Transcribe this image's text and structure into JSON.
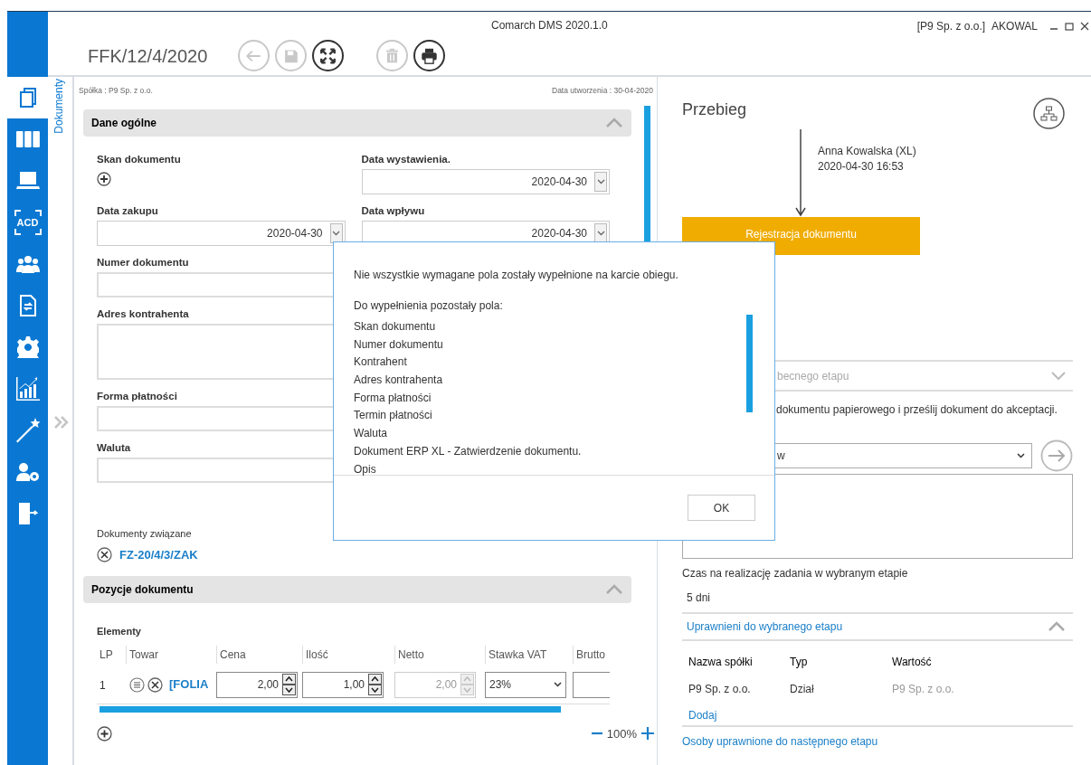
{
  "window": {
    "title": "Comarch DMS 2020.1.0",
    "company": "[P9 Sp. z o.o.]",
    "user": "AKOWAL"
  },
  "document": {
    "number": "FFK/12/4/2020"
  },
  "toolbar": [
    {
      "kind": "back",
      "disabled": true
    },
    {
      "kind": "save",
      "disabled": true
    },
    {
      "kind": "fullscreen",
      "disabled": false
    },
    {
      "kind": "delete",
      "disabled": true
    },
    {
      "kind": "print",
      "disabled": false
    }
  ],
  "sidebar": {
    "items": [
      {
        "kind": "documents",
        "selected": true
      },
      {
        "kind": "repository",
        "selected": false
      },
      {
        "kind": "workstation",
        "selected": false
      },
      {
        "kind": "ocr",
        "label": "ACD",
        "selected": false
      },
      {
        "kind": "users",
        "selected": false
      },
      {
        "kind": "workflow",
        "selected": false
      },
      {
        "kind": "settings",
        "selected": false
      },
      {
        "kind": "reports",
        "selected": false
      },
      {
        "kind": "wizard",
        "selected": false
      },
      {
        "kind": "user-settings",
        "selected": false
      },
      {
        "kind": "logout",
        "selected": false
      }
    ]
  },
  "side_tab": {
    "label": "Dokumenty"
  },
  "header_info": {
    "company": "Spółka : P9 Sp. z o.o.",
    "created": "Data utworzenia : 30-04-2020"
  },
  "general": {
    "title": "Dane ogólne",
    "expanded": true,
    "rows": [
      {
        "fields": [
          {
            "label": "Skan dokumentu",
            "kind": "attachment"
          },
          {
            "label": "Data wystawienia.",
            "kind": "date",
            "value": "2020-04-30"
          }
        ]
      },
      {
        "fields": [
          {
            "label": "Data zakupu",
            "kind": "date",
            "value": "2020-04-30"
          },
          {
            "label": "Data wpływu",
            "kind": "date",
            "value": "2020-04-30"
          }
        ]
      },
      {
        "fields": [
          {
            "label": "Numer dokumentu",
            "kind": "text"
          }
        ]
      },
      {
        "fields": [
          {
            "label": "Adres kontrahenta",
            "kind": "textarea"
          }
        ]
      },
      {
        "fields": [
          {
            "label": "Forma płatności",
            "kind": "text"
          }
        ]
      },
      {
        "fields": [
          {
            "label": "Waluta",
            "kind": "text"
          }
        ]
      }
    ]
  },
  "related": {
    "label": "Dokumenty związane",
    "items": [
      "FZ-20/4/3/ZAK"
    ]
  },
  "positions": {
    "title": "Pozycje dokumentu",
    "expanded": true,
    "subtitle": "Elementy",
    "columns": [
      "LP",
      "Towar",
      "Cena",
      "Ilość",
      "Netto",
      "Stawka VAT",
      "Brutto"
    ],
    "rows": [
      {
        "lp": "1",
        "product": "[FOLIA",
        "price": "2,00",
        "quantity": "1,00",
        "net": "2,00",
        "net_disabled": true,
        "vat": "23%"
      }
    ]
  },
  "zoom": {
    "value": "100%"
  },
  "flow": {
    "title": "Przebieg",
    "author": "Anna Kowalska (XL)",
    "time": "2020-04-30 16:53",
    "stage": "Rejestracja dokumentu",
    "stage_select": "becnego etapu",
    "instruction": "dokumentu papierowego i prześlij dokument do akceptacji.",
    "next_select": "w",
    "deadline_label": "Czas na realizację zadania w wybranym etapie",
    "deadline": "5 dni",
    "authorized": {
      "title": "Uprawnieni do wybranego etapu",
      "expanded": true,
      "columns": [
        "Nazwa spółki",
        "Typ",
        "Wartość"
      ],
      "rows": [
        [
          "P9 Sp. z o.o.",
          "Dział",
          "P9 Sp. z o.o."
        ]
      ],
      "add": "Dodaj"
    },
    "next_people": "Osoby uprawnione do następnego etapu"
  },
  "dialog": {
    "message": "Nie wszystkie wymagane pola zostały wypełnione na karcie obiegu.",
    "list_title": "Do wypełnienia pozostały pola:",
    "items": [
      "Skan dokumentu",
      "Numer dokumentu",
      "Kontrahent",
      "Adres kontrahenta",
      "Forma płatności",
      "Termin płatności",
      "Waluta",
      "Dokument ERP XL - Zatwierdzenie dokumentu.",
      "Opis"
    ],
    "button": "OK"
  }
}
